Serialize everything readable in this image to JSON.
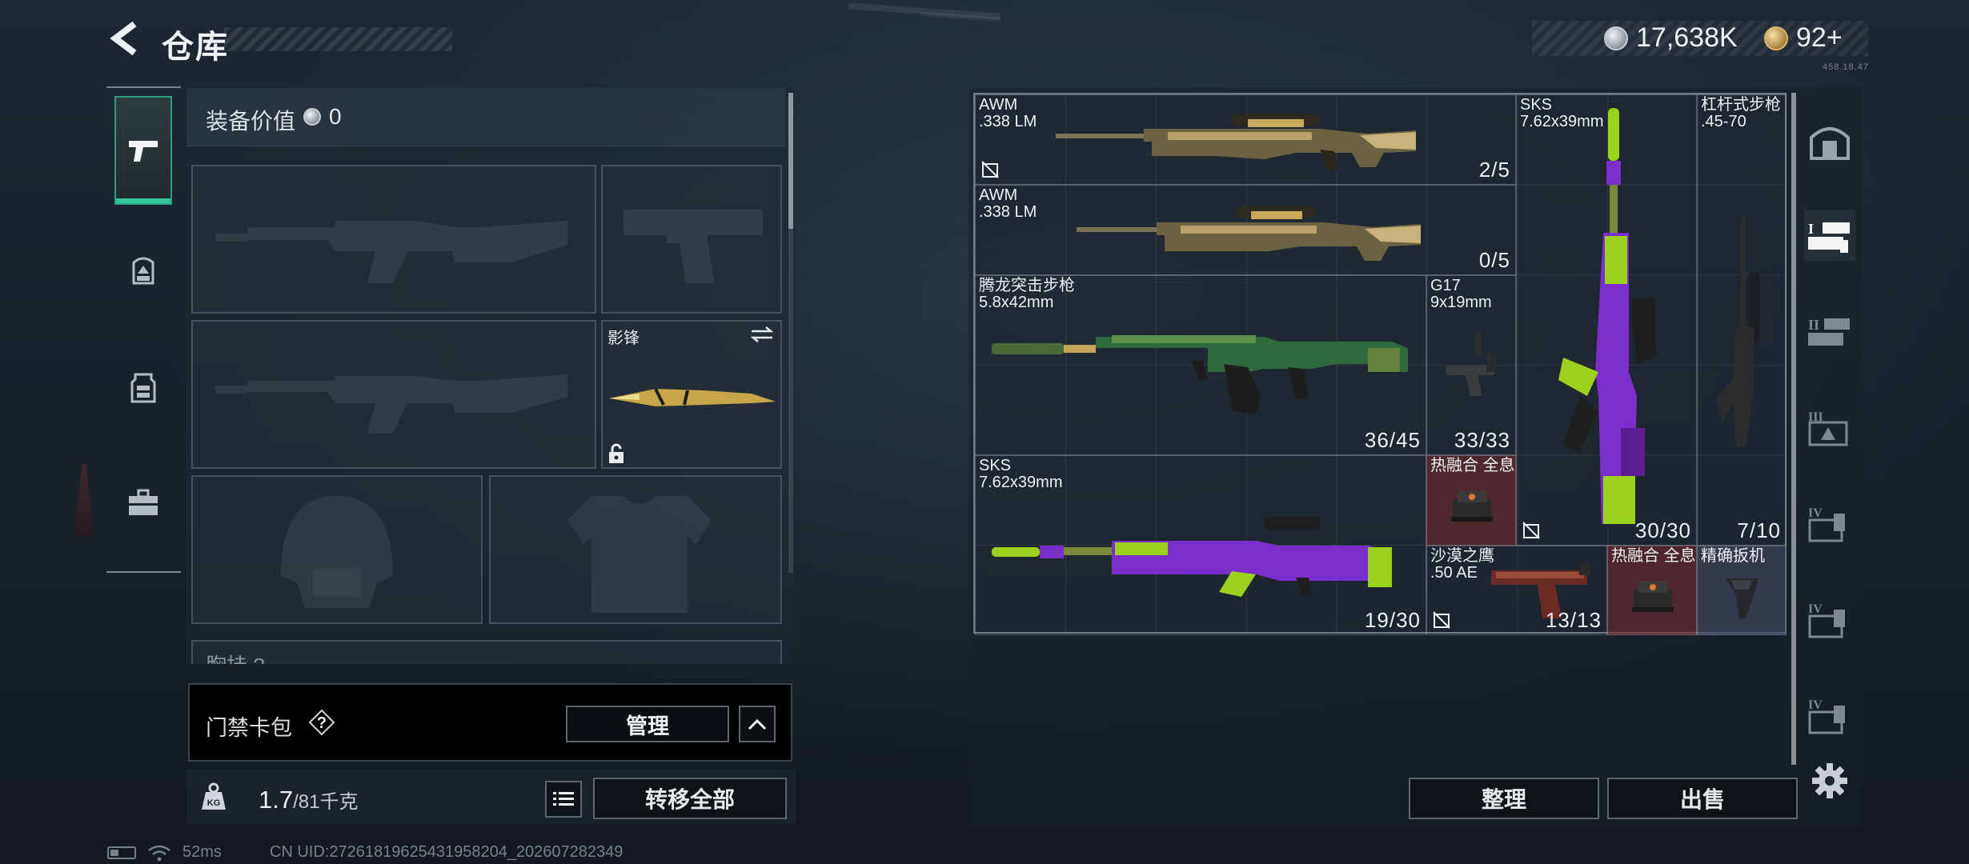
{
  "header": {
    "title": "仓库",
    "currency": [
      {
        "icon": "silver-coin-icon",
        "value": "17,638K"
      },
      {
        "icon": "gold-coin-icon",
        "value": "92+"
      }
    ],
    "tiny_id": "458.18.47"
  },
  "left_nav": [
    {
      "icon": "pistol-icon",
      "active": true
    },
    {
      "icon": "backpack-icon",
      "active": false
    },
    {
      "icon": "vest-icon",
      "active": false
    },
    {
      "icon": "toolbox-icon",
      "active": false
    }
  ],
  "equipment": {
    "value_label": "装备价值",
    "value": "0",
    "melee_label": "影锋",
    "chest_label": "胸挂 ?"
  },
  "access_card": {
    "label": "门禁卡包",
    "help": "?",
    "manage_label": "管理"
  },
  "bottom": {
    "weight_current": "1.7",
    "weight_capacity": "/81千克",
    "transfer_all_label": "转移全部"
  },
  "status": {
    "ping": "52ms",
    "uid": "CN UID:272618196254319582​04_202607282349"
  },
  "stash": {
    "items": [
      {
        "name": "AWM",
        "caliber": ".338 LM",
        "count": "2/5",
        "no_insure": true
      },
      {
        "name": "AWM",
        "caliber": ".338 LM",
        "count": "0/5",
        "no_insure": false
      },
      {
        "name": "腾龙突击步枪",
        "caliber": "5.8x42mm",
        "count": "36/45",
        "no_insure": false
      },
      {
        "name": "G17",
        "caliber": "9x19mm",
        "count": "33/33",
        "no_insure": false
      },
      {
        "name": "SKS",
        "caliber": "7.62x39mm",
        "count": "30/30",
        "no_insure": true
      },
      {
        "name": "杠杆式步枪",
        "caliber": ".45-70",
        "count": "7/10",
        "no_insure": false
      },
      {
        "name": "SKS",
        "caliber": "7.62x39mm",
        "count": "19/30",
        "no_insure": false
      },
      {
        "name": "热融合 全息",
        "caliber": "",
        "count": "",
        "no_insure": false
      },
      {
        "name": "沙漠之鹰",
        "caliber": ".50 AE",
        "count": "13/13",
        "no_insure": true
      },
      {
        "name": "热融合 全息",
        "caliber": "",
        "count": "",
        "no_insure": false
      },
      {
        "name": "精确扳机",
        "caliber": "",
        "count": "",
        "no_insure": false
      }
    ],
    "sort_label": "整理",
    "sell_label": "出售"
  },
  "right_tabs": [
    {
      "icon": "safe-box-icon",
      "label": ""
    },
    {
      "icon": "stash-page-icon",
      "label": "I"
    },
    {
      "icon": "stash-page-icon",
      "label": "II"
    },
    {
      "icon": "stash-page-icon",
      "label": "III"
    },
    {
      "icon": "stash-page-icon",
      "label": "IV"
    },
    {
      "icon": "stash-page-icon",
      "label": "IV"
    },
    {
      "icon": "stash-page-icon",
      "label": "IV"
    }
  ],
  "colors": {
    "accent_green": "#38c79b",
    "sks_purple": "#7b2ecc",
    "sks_lime": "#9ad21e",
    "red_slot": "#78282d"
  }
}
